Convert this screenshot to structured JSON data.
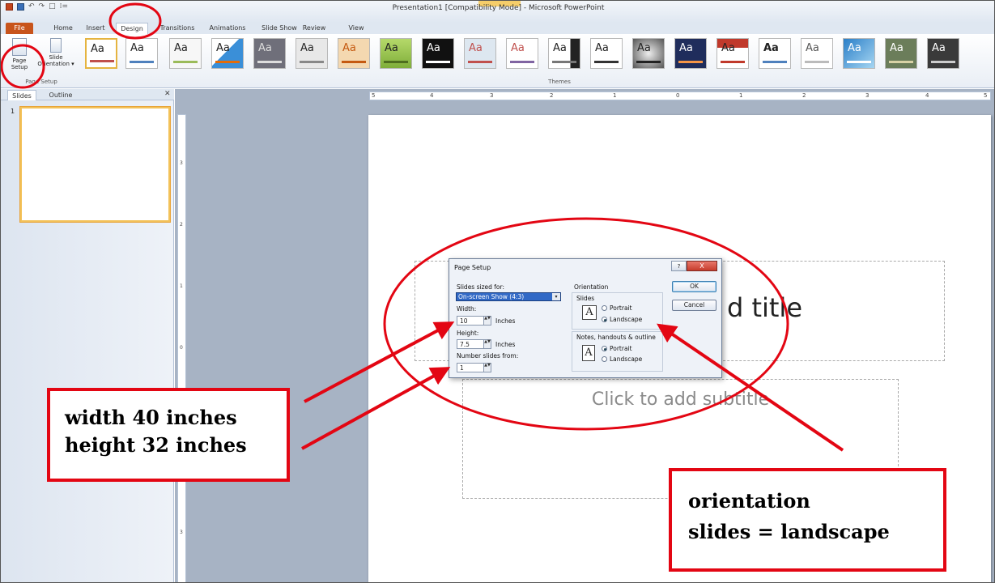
{
  "window": {
    "title": "Presentation1 [Compatibility Mode] - Microsoft PowerPoint"
  },
  "qat": {
    "undo": "↶",
    "redo": "↷",
    "new": "□",
    "more": "⁞="
  },
  "tabs": [
    {
      "label": "File"
    },
    {
      "label": "Home"
    },
    {
      "label": "Insert"
    },
    {
      "label": "Design"
    },
    {
      "label": "Transitions"
    },
    {
      "label": "Animations"
    },
    {
      "label": "Slide Show"
    },
    {
      "label": "Review"
    },
    {
      "label": "View"
    }
  ],
  "ribbon": {
    "page_setup_label": "Page Setup",
    "slide_orientation_label": "Slide Orientation ▾",
    "page_setup_group": "Page Setup",
    "themes_group": "Themes",
    "theme_glyph": "Aa"
  },
  "pane": {
    "tab_slides": "Slides",
    "tab_outline": "Outline",
    "close": "✕",
    "slide_number": "1"
  },
  "ruler": {
    "h_ticks": [
      "5",
      "4",
      "3",
      "2",
      "1",
      "0",
      "1",
      "2",
      "3",
      "4",
      "5"
    ],
    "v_ticks": [
      "3",
      "2",
      "1",
      "0",
      "1",
      "2",
      "3"
    ]
  },
  "slide": {
    "title_placeholder": "d title",
    "subtitle_placeholder": "Click to add subtitle"
  },
  "dialog": {
    "title": "Page Setup",
    "help": "?",
    "close": "X",
    "slides_sized_for_label": "Slides sized for:",
    "slides_sized_for_value": "On-screen Show (4:3)",
    "width_label": "Width:",
    "width_value": "10",
    "height_label": "Height:",
    "height_value": "7.5",
    "units": "Inches",
    "number_from_label": "Number slides from:",
    "number_from_value": "1",
    "orientation_label": "Orientation",
    "slides_label": "Slides",
    "portrait": "Portrait",
    "landscape": "Landscape",
    "notes_label": "Notes, handouts & outline",
    "ok": "OK",
    "cancel": "Cancel",
    "orientation_glyph": "A",
    "dropdown_glyph": "▾",
    "spin_glyph": "▲▼"
  },
  "annotations": {
    "size_line1": "width 40 inches",
    "size_line2": "height 32 inches",
    "orient_line1": "orientation",
    "orient_line2": "slides = landscape"
  },
  "colors": {
    "annotation_red": "#e30613",
    "file_tab": "#c8541b",
    "selection_blue": "#3169c6"
  }
}
